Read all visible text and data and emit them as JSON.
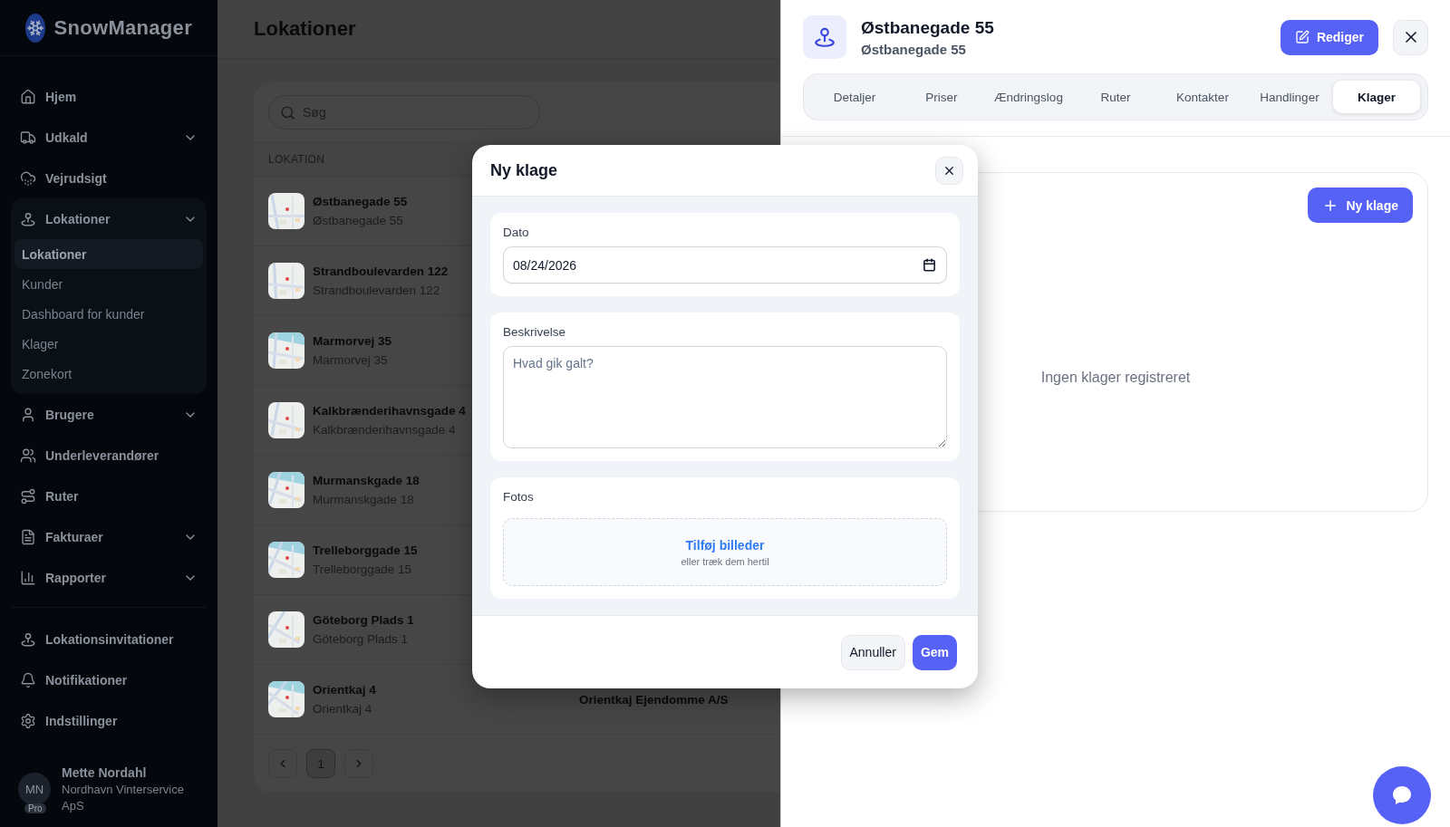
{
  "app": {
    "name": "SnowManager"
  },
  "sidebar": {
    "items": [
      {
        "label": "Hjem"
      },
      {
        "label": "Udkald",
        "expanded": false
      },
      {
        "label": "Vejrudsigt"
      },
      {
        "label": "Lokationer",
        "expanded": true,
        "children": [
          {
            "label": "Lokationer",
            "selected": true
          },
          {
            "label": "Kunder",
            "selected": false
          },
          {
            "label": "Dashboard for kunder",
            "selected": false
          },
          {
            "label": "Klager",
            "selected": false
          },
          {
            "label": "Zonekort",
            "selected": false
          }
        ]
      },
      {
        "label": "Brugere",
        "expanded": false
      },
      {
        "label": "Underleverandører"
      },
      {
        "label": "Ruter"
      },
      {
        "label": "Fakturaer",
        "expanded": false
      },
      {
        "label": "Rapporter",
        "expanded": false
      }
    ],
    "bottom_items": [
      {
        "label": "Lokationsinvitationer"
      },
      {
        "label": "Notifikationer"
      },
      {
        "label": "Indstillinger"
      }
    ],
    "user": {
      "initials": "MN",
      "badge": "Pro",
      "name": "Mette Nordahl",
      "company": "Nordhavn Vinterservice ApS"
    }
  },
  "page": {
    "title": "Lokationer",
    "search": {
      "placeholder": "Søg"
    },
    "table": {
      "columns": [
        "LOKATION"
      ],
      "rows": [
        {
          "name": "Østbanegade 55",
          "address": "Østbanegade 55"
        },
        {
          "name": "Strandboulevarden 122",
          "address": "Strandboulevarden 122"
        },
        {
          "name": "Marmorvej 35",
          "address": "Marmorvej 35"
        },
        {
          "name": "Kalkbrænderihavnsgade 4",
          "address": "Kalkbrænderihavnsgade 4"
        },
        {
          "name": "Murmanskgade 18",
          "address": "Murmanskgade 18"
        },
        {
          "name": "Trelleborggade 15",
          "address": "Trelleborggade 15"
        },
        {
          "name": "Göteborg Plads 1",
          "address": "Göteborg Plads 1"
        },
        {
          "name": "Orientkaj 4",
          "address": "Orientkaj 4",
          "column_2": "Orientkaj Ejendomme A/S"
        }
      ]
    },
    "pagination": {
      "pages": [
        {
          "label": "1",
          "selected": true
        }
      ]
    }
  },
  "drawer": {
    "title": "Østbanegade 55",
    "subtitle": "Østbanegade 55",
    "edit_button": "Rediger",
    "tabs": [
      {
        "label": "Detaljer",
        "selected": false
      },
      {
        "label": "Priser",
        "selected": false
      },
      {
        "label": "Ændringslog",
        "selected": false
      },
      {
        "label": "Ruter",
        "selected": false
      },
      {
        "label": "Kontakter",
        "selected": false
      },
      {
        "label": "Handlinger",
        "selected": false
      },
      {
        "label": "Klager",
        "selected": true
      }
    ],
    "complaints": {
      "add_button": "Ny klage",
      "empty_text": "Ingen klager registreret"
    }
  },
  "modal": {
    "title": "Ny klage",
    "fields": [
      {
        "kind": "date",
        "label": "Dato",
        "value": "08/24/2026"
      },
      {
        "kind": "textarea",
        "label": "Beskrivelse",
        "placeholder": "Hvad gik galt?"
      },
      {
        "kind": "upload",
        "label": "Fotos",
        "link": "Tilføj billeder",
        "hint": "eller træk dem hertil"
      }
    ],
    "buttons": [
      {
        "label": "Annuller",
        "kind": "secondary"
      },
      {
        "label": "Gem",
        "kind": "primary"
      }
    ]
  }
}
